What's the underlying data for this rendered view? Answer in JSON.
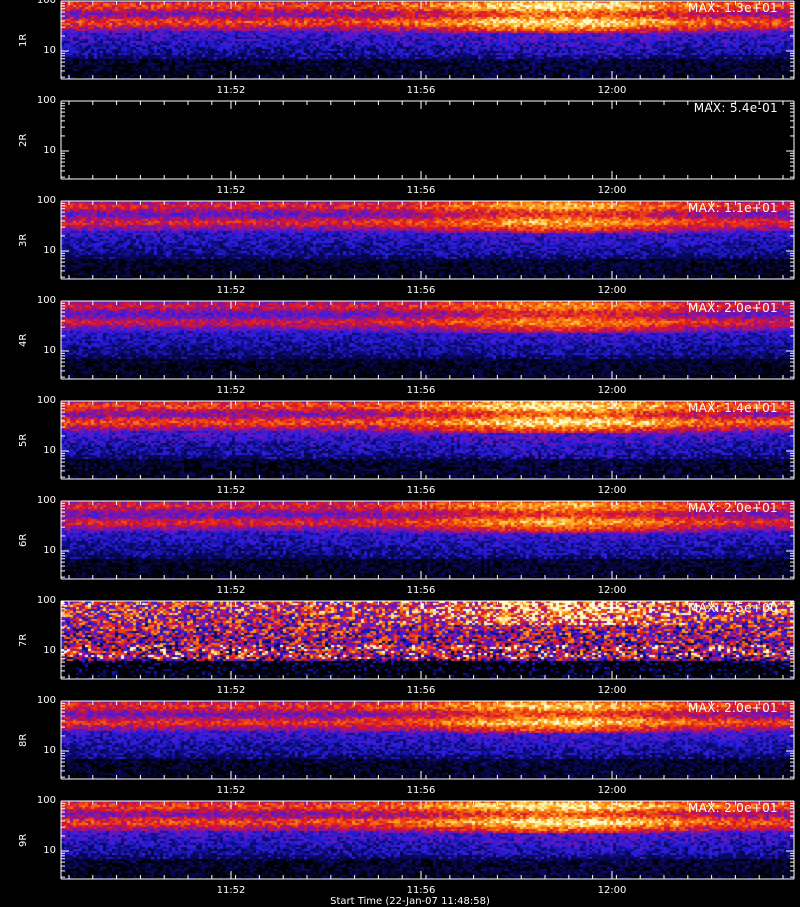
{
  "colors": {
    "background": "#000000",
    "axis": "#ffffff",
    "text": "#ffffff"
  },
  "chart_data": [
    {
      "type": "heatmap",
      "ylabel": "1R",
      "max_label": "MAX: 1.3e+01",
      "yscale": "log",
      "yticks": [
        "100",
        "10"
      ],
      "xticks": [
        "11:52",
        "11:56",
        "12:00"
      ],
      "intensity": 0.95
    },
    {
      "type": "heatmap",
      "ylabel": "2R",
      "max_label": "MAX: 5.4e-01",
      "yscale": "log",
      "yticks": [
        "100",
        "10"
      ],
      "xticks": [
        "11:52",
        "11:56",
        "12:00"
      ],
      "intensity": 0.0
    },
    {
      "type": "heatmap",
      "ylabel": "3R",
      "max_label": "MAX: 1.1e+01",
      "yscale": "log",
      "yticks": [
        "100",
        "10"
      ],
      "xticks": [
        "11:52",
        "11:56",
        "12:00"
      ],
      "intensity": 0.85
    },
    {
      "type": "heatmap",
      "ylabel": "4R",
      "max_label": "MAX: 2.0e+01",
      "yscale": "log",
      "yticks": [
        "100",
        "10"
      ],
      "xticks": [
        "11:52",
        "11:56",
        "12:00"
      ],
      "intensity": 0.8
    },
    {
      "type": "heatmap",
      "ylabel": "5R",
      "max_label": "MAX: 1.4e+01",
      "yscale": "log",
      "yticks": [
        "100",
        "10"
      ],
      "xticks": [
        "11:52",
        "11:56",
        "12:00"
      ],
      "intensity": 0.95
    },
    {
      "type": "heatmap",
      "ylabel": "6R",
      "max_label": "MAX: 2.0e+01",
      "yscale": "log",
      "yticks": [
        "100",
        "10"
      ],
      "xticks": [
        "11:52",
        "11:56",
        "12:00"
      ],
      "intensity": 0.85
    },
    {
      "type": "heatmap",
      "ylabel": "7R",
      "max_label": "MAX: 2.5e+00",
      "yscale": "log",
      "yticks": [
        "100",
        "10"
      ],
      "xticks": [
        "11:52",
        "11:56",
        "12:00"
      ],
      "intensity": 1.0,
      "noisy": true
    },
    {
      "type": "heatmap",
      "ylabel": "8R",
      "max_label": "MAX: 2.0e+01",
      "yscale": "log",
      "yticks": [
        "100",
        "10"
      ],
      "xticks": [
        "11:52",
        "11:56",
        "12:00"
      ],
      "intensity": 0.9
    },
    {
      "type": "heatmap",
      "ylabel": "9R",
      "max_label": "MAX: 2.0e+01",
      "yscale": "log",
      "yticks": [
        "100",
        "10"
      ],
      "xticks": [
        "11:52",
        "11:56",
        "12:00"
      ],
      "intensity": 0.95
    }
  ],
  "xaxis_title": "Start Time (22-Jan-07 11:48:58)"
}
